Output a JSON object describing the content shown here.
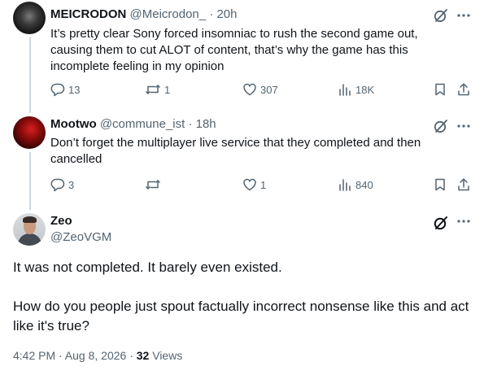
{
  "replies": [
    {
      "name": "MEICRODON",
      "handle": "@Meicrodon_",
      "sep": "·",
      "time": "20h",
      "text": "It’s pretty clear Sony forced insomniac to rush the second game out, causing them to cut ALOT of content, that’s why the game has this incomplete feeling in my opinion",
      "replies": "13",
      "reposts": "1",
      "likes": "307",
      "views": "18K"
    },
    {
      "name": "Mootwo",
      "handle": "@commune_ist",
      "sep": "·",
      "time": "18h",
      "text": "Don’t forget the multiplayer live service that they completed and then cancelled",
      "replies": "3",
      "reposts": "",
      "likes": "1",
      "views": "840"
    }
  ],
  "focus": {
    "name": "Zeo",
    "handle": "@ZeoVGM",
    "paragraph1": "It was not completed. It barely even existed.",
    "paragraph2": "How do you people just spout factually incorrect nonsense like this and act like it's true?",
    "timestamp": "4:42 PM · Aug 8, 2026 · ",
    "views_count": "32",
    "views_label": " Views"
  },
  "icons": {
    "grok": "grok-icon",
    "more": "more-icon",
    "reply": "reply-icon",
    "repost": "repost-icon",
    "like": "heart-icon",
    "views": "views-icon",
    "bookmark": "bookmark-icon",
    "share": "share-icon"
  },
  "colors": {
    "text": "#0f1419",
    "secondary": "#536471",
    "thread_line": "#cfd9de"
  }
}
